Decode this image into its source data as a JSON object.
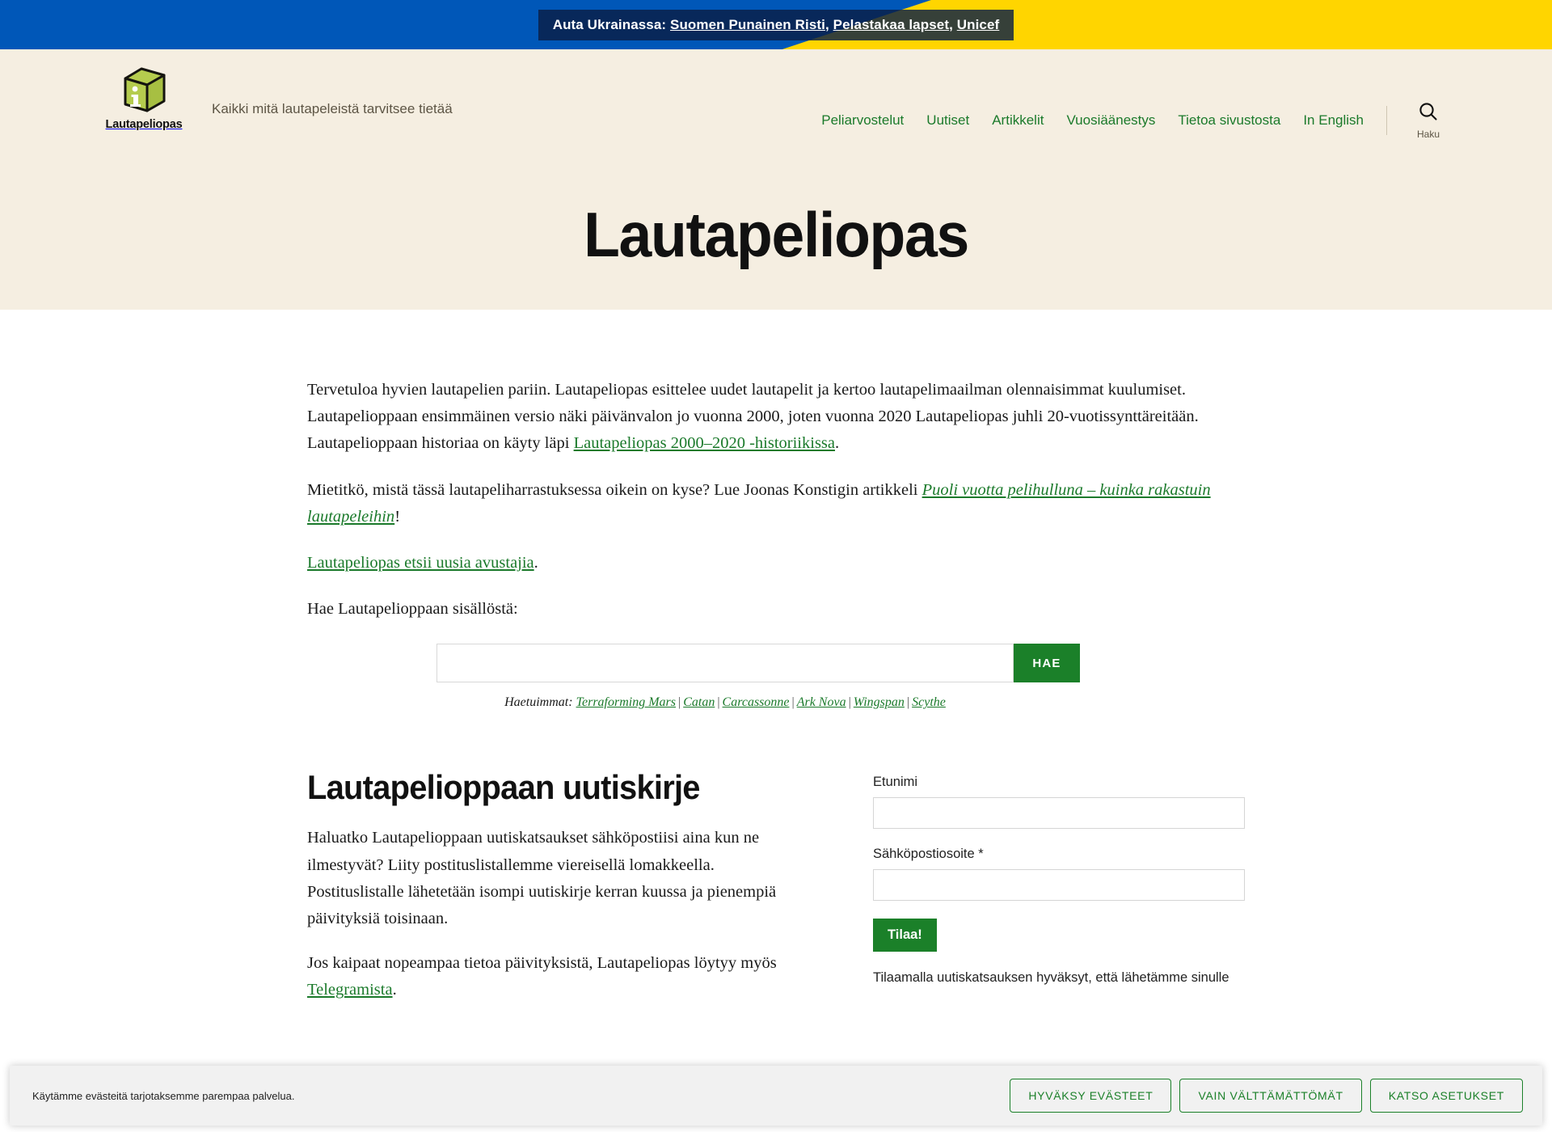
{
  "colors": {
    "accent_green": "#1b7a2b",
    "button_green": "#1b8029",
    "hero_bg": "#f5eee1",
    "ukraine_blue": "#0057b8",
    "ukraine_yellow": "#ffd500"
  },
  "ukraine_banner": {
    "prefix": "Auta Ukrainassa: ",
    "links": [
      {
        "label": "Suomen Punainen Risti"
      },
      {
        "label": "Pelastakaa lapset"
      },
      {
        "label": "Unicef"
      }
    ],
    "separator": ", "
  },
  "header": {
    "logo_word": "Lautapeliopas",
    "logo_icon": "info-cube-icon",
    "tagline": "Kaikki mitä lautapeleistä tarvitsee tietää",
    "nav": [
      {
        "label": "Peliarvostelut"
      },
      {
        "label": "Uutiset"
      },
      {
        "label": "Artikkelit"
      },
      {
        "label": "Vuosiäänestys"
      },
      {
        "label": "Tietoa sivustosta"
      },
      {
        "label": "In English"
      }
    ],
    "search": {
      "icon": "search-icon",
      "label": "Haku"
    }
  },
  "hero": {
    "title": "Lautapeliopas"
  },
  "intro": {
    "p1_part1": "Tervetuloa hyvien lautapelien pariin. Lautapeliopas esittelee uudet lautapelit ja kertoo lautapelimaailman olennaisimmat kuulumiset. Lautapelioppaan ensimmäinen versio näki päivänvalon jo vuonna 2000, joten vuonna 2020 Lautapeliopas juhli 20-vuotissynttäreitään. Lautapelioppaan historiaa on käyty läpi ",
    "p1_link": "Lautapeliopas 2000–2020 -historiikissa",
    "p1_part2": ".",
    "p2_part1": "Mietitkö, mistä tässä lautapeliharrastuksessa oikein on kyse? Lue Joonas Konstigin artikkeli ",
    "p2_link": "Puoli vuotta pelihulluna – kuinka rakastuin lautapeleihin",
    "p2_part2": "!",
    "p3_link": "Lautapeliopas etsii uusia avustajia",
    "p3_part2": ".",
    "p4": "Hae Lautapelioppaan sisällöstä:"
  },
  "search_form": {
    "input_value": "",
    "input_placeholder": "",
    "submit_label": "HAE",
    "popular_label": "Haetuimmat:",
    "popular_links": [
      {
        "label": "Terraforming Mars"
      },
      {
        "label": "Catan"
      },
      {
        "label": "Carcassonne"
      },
      {
        "label": "Ark Nova"
      },
      {
        "label": "Wingspan"
      },
      {
        "label": "Scythe"
      }
    ],
    "popular_separator": "|"
  },
  "newsletter": {
    "title": "Lautapelioppaan uutiskirje",
    "p1": "Haluatko Lautapelioppaan uutiskatsaukset sähköpostiisi aina kun ne ilmestyvät? Liity postituslistallemme viereisellä lomakkeella. Postituslistalle lähetetään isompi uutiskirje kerran kuussa ja pienempiä päivityksiä toisinaan.",
    "p2_part1": "Jos kaipaat nopeampaa tietoa päivityksistä, Lautapeliopas löytyy myös ",
    "p2_link": "Telegramista",
    "p2_part2": ".",
    "form": {
      "firstname_label": "Etunimi",
      "firstname_value": "",
      "email_label": "Sähköpostiosoite *",
      "email_value": "",
      "submit_label": "Tilaa!",
      "consent_text": "Tilaamalla uutiskatsauksen hyväksyt, että lähetämme sinulle"
    }
  },
  "cookie_banner": {
    "text": "Käytämme evästeitä tarjotaksemme parempaa palvelua.",
    "buttons": [
      {
        "label": "HYVÄKSY EVÄSTEET"
      },
      {
        "label": "VAIN VÄLTTÄMÄTTÖMÄT"
      },
      {
        "label": "KATSO ASETUKSET"
      }
    ]
  }
}
